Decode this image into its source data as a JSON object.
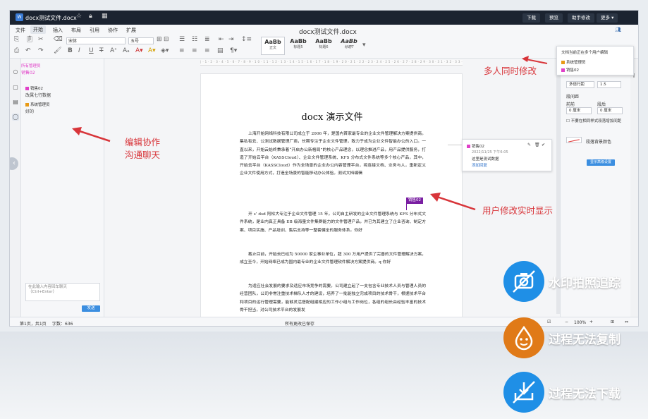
{
  "colors": {
    "accent": "#3b8ee0",
    "callout": "#d8353a",
    "user_pink": "#e040c8",
    "user_orange": "#e89a16",
    "cursor_purple": "#7a1fa2",
    "feature_blue": "#1f8fe6",
    "feature_orange": "#e07a18"
  },
  "titlebar": {
    "filename": "docx测试文件.docx",
    "buttons": [
      "下载",
      "预览",
      "助手修改",
      "更多"
    ]
  },
  "menu": {
    "items": [
      "文件",
      "开始",
      "插入",
      "布局",
      "引用",
      "协作",
      "扩展"
    ],
    "active": "开始"
  },
  "doc_title": "docx测试文件.docx",
  "ribbon": {
    "font": "宋体",
    "size": "五号",
    "styles": [
      {
        "label": "AaBb",
        "name": "正文"
      },
      {
        "label": "AaBb",
        "name": "标题5"
      },
      {
        "label": "AaBb",
        "name": "标题6"
      },
      {
        "label": "AaBb",
        "name": "标题7"
      }
    ]
  },
  "chat": {
    "messages": [
      {
        "name": "所有管理员",
        "text": "销售02"
      },
      {
        "name": "销售02",
        "text": "改属七行数据"
      },
      {
        "name": "系统管理员",
        "text": "好的"
      }
    ],
    "input_placeholder": "在此输入内容回车聊天\n（Ctrl+Enter）",
    "send": "发送"
  },
  "document": {
    "heading": "docx 演示文件",
    "paragraphs": [
      "上海开始网络科技有限公司成立于 2006 年，是国内首家最专业的企业文件管理解决方案提供商。集私有云、公测试数据管理厂商，长期专注于企业文件管理，致力于成为企业文件智能办公的入口。一直以来，开始云始终秉承着“开启办公新格局”的核心产品理念，以理念推进产品，用产品提供服务，打造了开始云平台（KASSCloud）、企业文件管理系统、KFS 分布式文件系统等多个核心产品，其中，开始云平台（KASSCloud）作为全场景的企业办公内容管理平台，将连接文档、业务与人，重新定义企业文件使用方式，打造全场景的智能移动办公体验。测试文档编辑",
      "开 s’ dsd 阿松大专注于企业文件管理 15 年，公司自主研发的企业文件管理系统与 KFS 分布式文件系统，是业内真正具备 EB 级海量文件集群能力的文件管理产品，并已为其建立了企业咨询、制定方案、项目实施、产品培训、售后支持等一整套健全的服务体系。你好",
      "截止目前，开始云已经为 50000 家企事业单位，超 300 万用户提供了完善的文件管理解决方案，成立至今，开始网络已成为国内最专业的企业文件管理软件解决方案提供商。q 你好",
      "为适应社会发展的要求及适应市场竞争的需要，公司建立起了一支包含专业技术人员与管理人员的经营团队，公司非常注重技术梯队人才的建设，培养了一批能独立完成项目的技术骨干，根据技术平台和项目的运行管理需要，能够灵活搭配组建相应的工作小组与工作岗位，各组的组长由经验丰富的技术骨干担当，对公司技术平台的发展发"
    ]
  },
  "cursor_label": "销售02",
  "comment": {
    "author": "销售02",
    "time": "2022/11/25 下午6:05",
    "text": "这里是测试数据",
    "action": "添加回复"
  },
  "users_popup": {
    "title": "文档当前正在多个用户编辑",
    "users": [
      "系统管理员",
      "销售02"
    ]
  },
  "right_panel": {
    "line_spacing_label": "多倍行距",
    "line_spacing": "1.5",
    "para_spacing": "段间距",
    "before": "前前",
    "after": "段后",
    "before_val": "0 厘米",
    "after_val": "0 厘米",
    "checkbox": "不要在相同样式段落增加间距",
    "bg_color": "段落背景颜色",
    "advanced": "显示高级设置"
  },
  "statusbar": {
    "pages": "第1页，共1页",
    "words": "字数：636",
    "saved": "所有更改已保存",
    "zoom": "100%"
  },
  "callouts": {
    "multi_user": "多人同时修改",
    "chat": "编辑协作\n沟通聊天",
    "realtime": "用户修改实时显示"
  },
  "features": [
    {
      "label": "水印拍照追踪",
      "icon": "camera-off-icon"
    },
    {
      "label": "过程无法复制",
      "icon": "no-copy-icon"
    },
    {
      "label": "过程无法下载",
      "icon": "no-download-icon"
    }
  ]
}
